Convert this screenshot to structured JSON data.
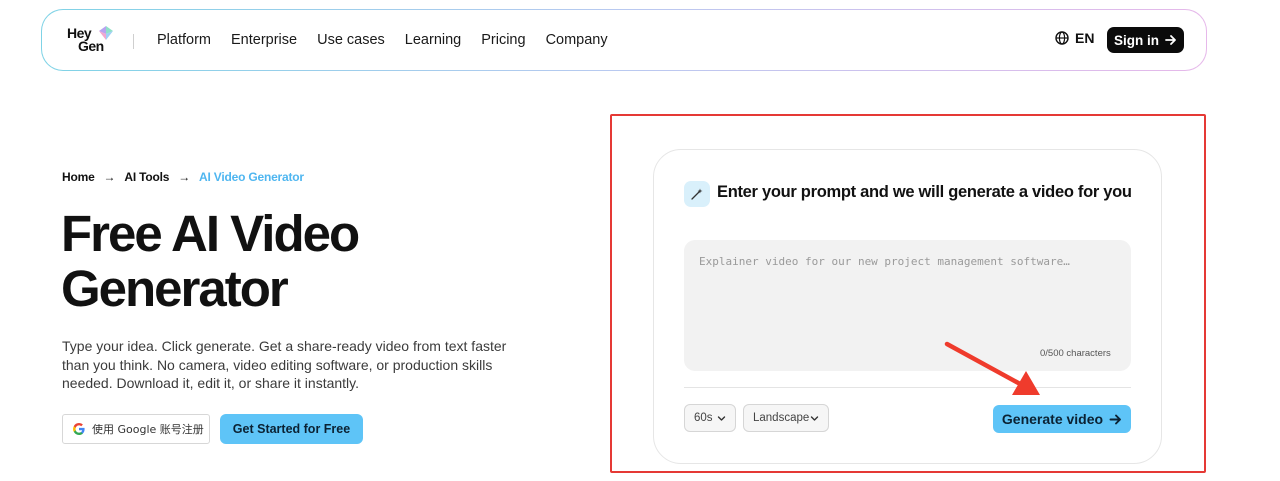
{
  "nav": {
    "logo_line1": "Hey",
    "logo_line2": "Gen",
    "links": [
      "Platform",
      "Enterprise",
      "Use cases",
      "Learning",
      "Pricing",
      "Company"
    ],
    "language": "EN",
    "signin_label": "Sign in"
  },
  "breadcrumb": {
    "home": "Home",
    "ai_tools": "AI Tools",
    "current": "AI Video Generator"
  },
  "hero": {
    "title": "Free AI Video Generator",
    "description": "Type your idea. Click generate. Get a share-ready video from text faster than you think. No camera, video editing software, or production skills needed. Download it, edit it, or share it instantly.",
    "google_button": "使用 Google 账号注册",
    "start_button": "Get Started for Free"
  },
  "generator": {
    "heading": "Enter your prompt and we will generate a video for you",
    "prompt_placeholder": "Explainer video for our new project management software…",
    "char_count": "0/500 characters",
    "duration": "60s",
    "orientation": "Landscape",
    "generate_button": "Generate video"
  },
  "colors": {
    "accent": "#5ec4f7",
    "breadcrumb_active": "#4fb6f0",
    "highlight": "#e53935",
    "annotation_arrow": "#ef3b2c"
  }
}
